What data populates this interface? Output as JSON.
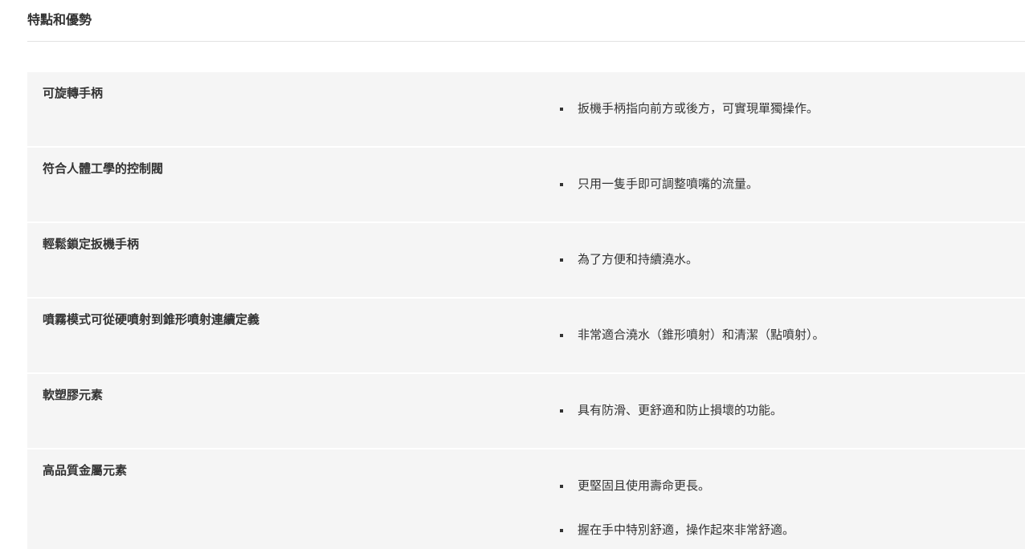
{
  "section": {
    "title": "特點和優勢"
  },
  "features": [
    {
      "name": "可旋轉手柄",
      "benefits": [
        "扳機手柄指向前方或後方，可實現單獨操作。"
      ]
    },
    {
      "name": "符合人體工學的控制閥",
      "benefits": [
        "只用一隻手即可調整噴嘴的流量。"
      ]
    },
    {
      "name": "輕鬆鎖定扳機手柄",
      "benefits": [
        "為了方便和持續澆水。"
      ]
    },
    {
      "name": "噴霧模式可從硬噴射到錐形噴射連續定義",
      "benefits": [
        "非常適合澆水（錐形噴射）和清潔（點噴射）。"
      ]
    },
    {
      "name": "軟塑膠元素",
      "benefits": [
        "具有防滑、更舒適和防止損壞的功能。"
      ]
    },
    {
      "name": "高品質金屬元素",
      "benefits": [
        "更堅固且使用壽命更長。",
        "握在手中特別舒適，操作起來非常舒適。"
      ]
    }
  ]
}
